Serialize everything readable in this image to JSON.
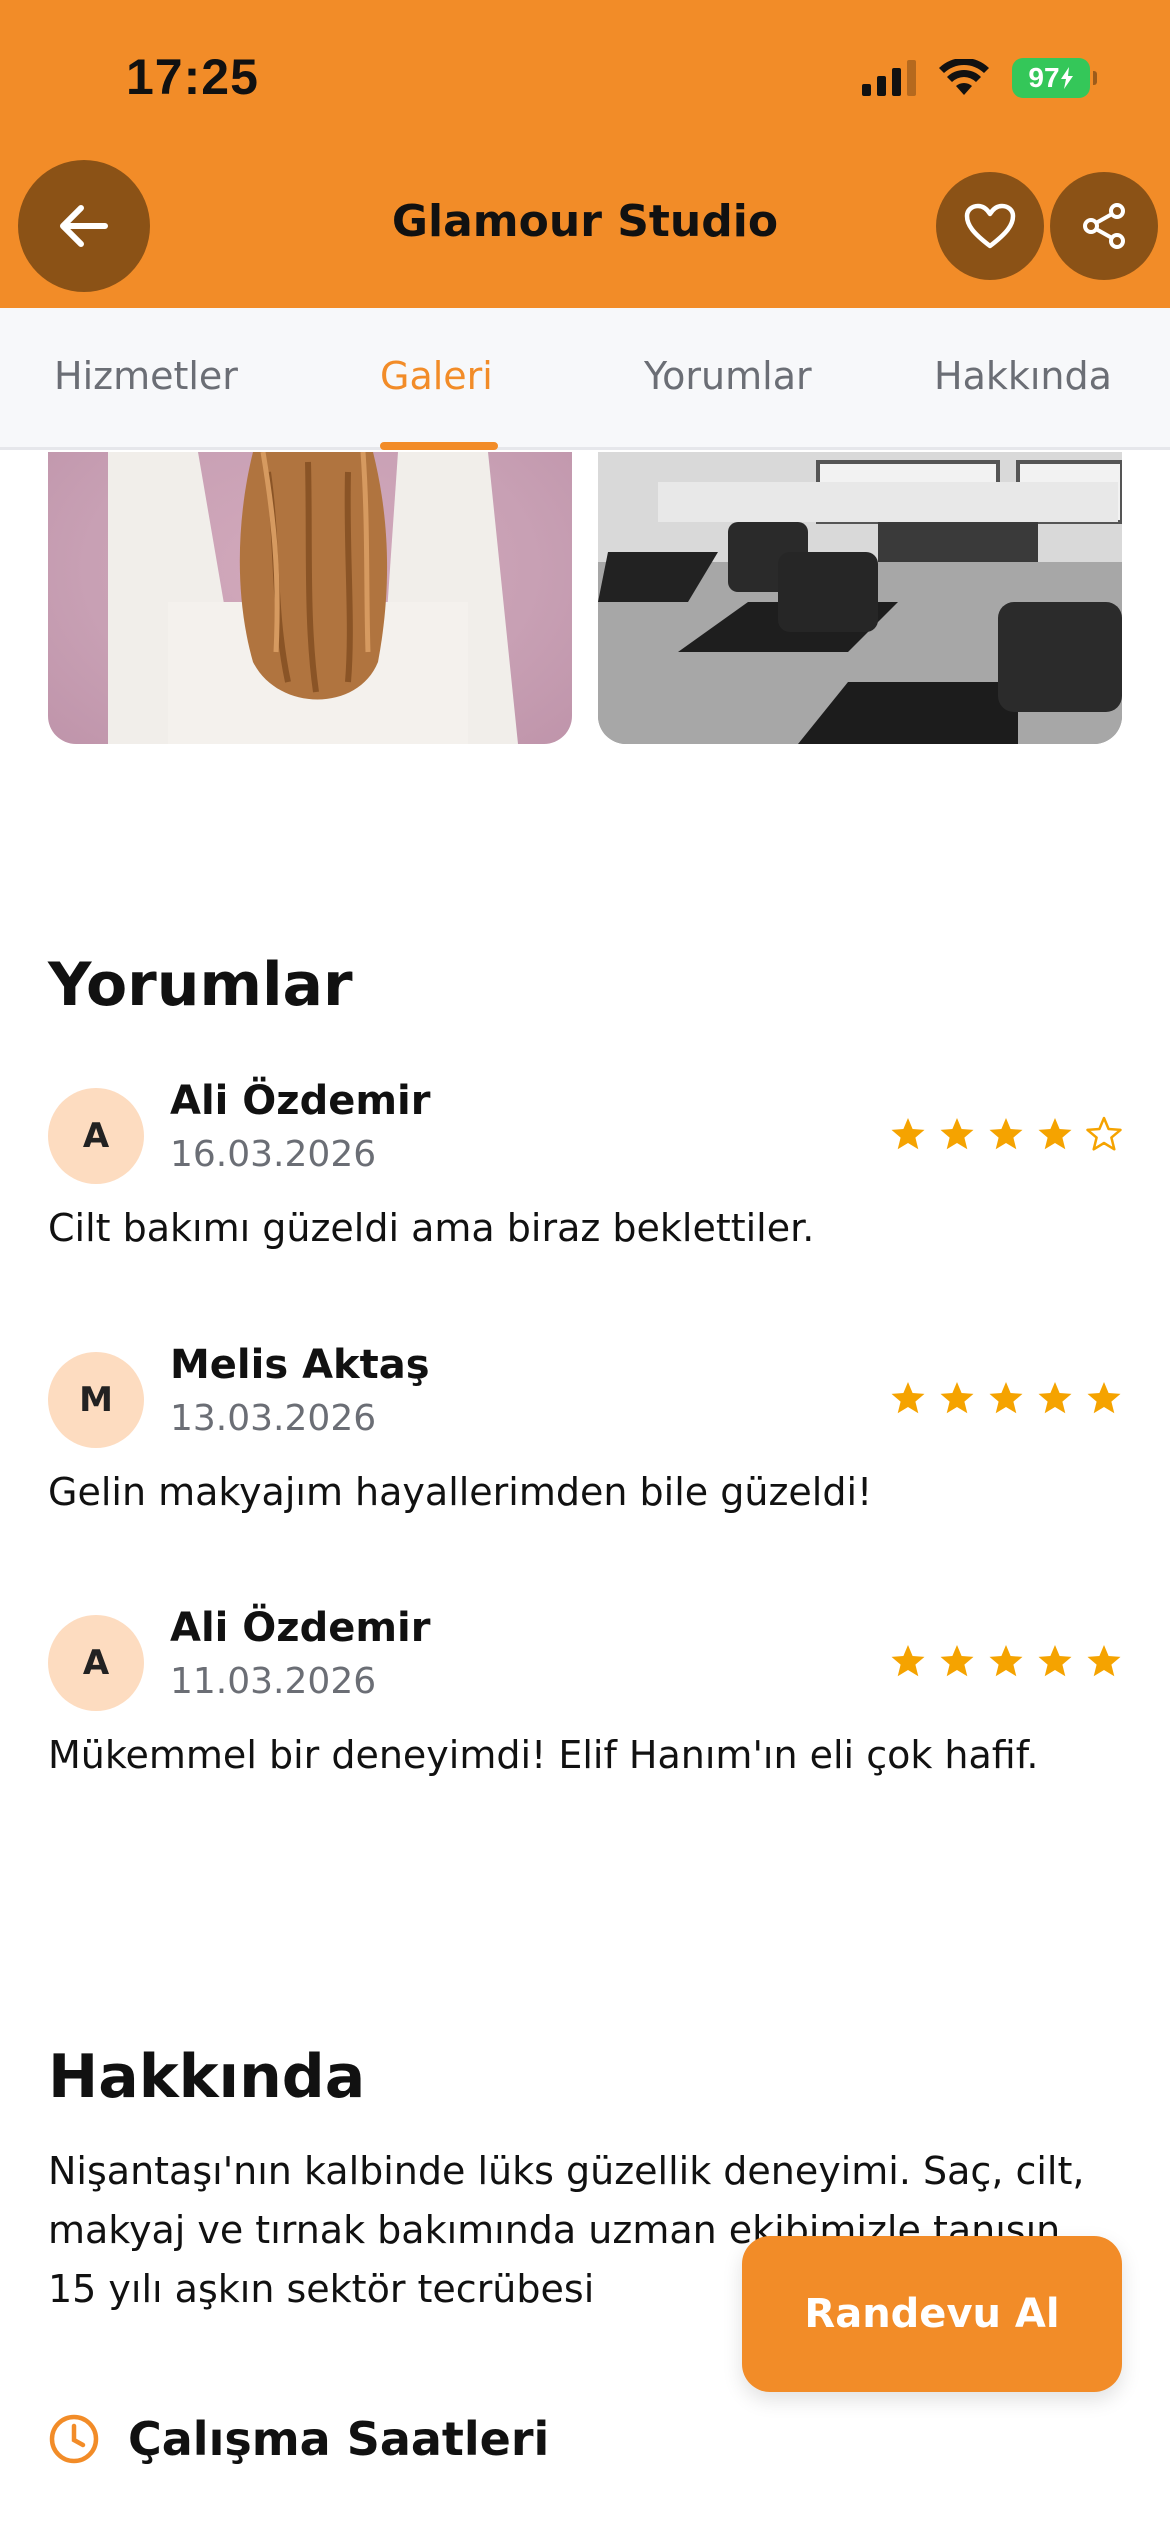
{
  "status_bar": {
    "time": "17:25",
    "battery": "97"
  },
  "header": {
    "title": "Glamour Studio"
  },
  "tabs": [
    {
      "label": "Hizmetler",
      "active": false
    },
    {
      "label": "Galeri",
      "active": true
    },
    {
      "label": "Yorumlar",
      "active": false
    },
    {
      "label": "Hakkında",
      "active": false
    }
  ],
  "reviews_section": {
    "title": "Yorumlar",
    "items": [
      {
        "initial": "A",
        "name": "Ali Özdemir",
        "date": "16.03.2026",
        "rating": 4,
        "text": "Cilt bakımı güzeldi ama biraz beklettiler."
      },
      {
        "initial": "M",
        "name": "Melis Aktaş",
        "date": "13.03.2026",
        "rating": 5,
        "text": "Gelin makyajım hayallerimden bile güzeldi!"
      },
      {
        "initial": "A",
        "name": "Ali Özdemir",
        "date": "11.03.2026",
        "rating": 5,
        "text": "Mükemmel bir deneyimdi! Elif Hanım'ın eli çok hafif."
      }
    ]
  },
  "about_section": {
    "title": "Hakkında",
    "text": "Nişantaşı'nın kalbinde lüks güzellik deneyimi. Saç, cilt, makyaj ve tırnak bakımında uzman ekibimizle tanışın. 15 yılı aşkın sektör tecrübesi",
    "hours_label": "Çalışma Saatleri"
  },
  "cta": {
    "label": "Randevu Al"
  },
  "colors": {
    "accent": "#F28C28",
    "accent_dark": "#8B5216",
    "star": "#F5A300",
    "avatar_bg": "#FDDCC0"
  }
}
